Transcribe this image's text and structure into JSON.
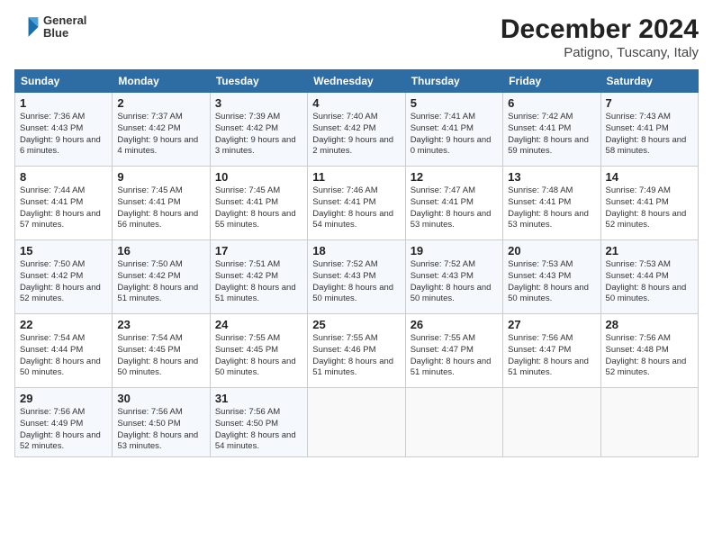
{
  "logo": {
    "line1": "General",
    "line2": "Blue"
  },
  "title": "December 2024",
  "subtitle": "Patigno, Tuscany, Italy",
  "weekdays": [
    "Sunday",
    "Monday",
    "Tuesday",
    "Wednesday",
    "Thursday",
    "Friday",
    "Saturday"
  ],
  "weeks": [
    [
      {
        "day": "1",
        "sunrise": "7:36 AM",
        "sunset": "4:43 PM",
        "daylight": "9 hours and 6 minutes."
      },
      {
        "day": "2",
        "sunrise": "7:37 AM",
        "sunset": "4:42 PM",
        "daylight": "9 hours and 4 minutes."
      },
      {
        "day": "3",
        "sunrise": "7:39 AM",
        "sunset": "4:42 PM",
        "daylight": "9 hours and 3 minutes."
      },
      {
        "day": "4",
        "sunrise": "7:40 AM",
        "sunset": "4:42 PM",
        "daylight": "9 hours and 2 minutes."
      },
      {
        "day": "5",
        "sunrise": "7:41 AM",
        "sunset": "4:41 PM",
        "daylight": "9 hours and 0 minutes."
      },
      {
        "day": "6",
        "sunrise": "7:42 AM",
        "sunset": "4:41 PM",
        "daylight": "8 hours and 59 minutes."
      },
      {
        "day": "7",
        "sunrise": "7:43 AM",
        "sunset": "4:41 PM",
        "daylight": "8 hours and 58 minutes."
      }
    ],
    [
      {
        "day": "8",
        "sunrise": "7:44 AM",
        "sunset": "4:41 PM",
        "daylight": "8 hours and 57 minutes."
      },
      {
        "day": "9",
        "sunrise": "7:45 AM",
        "sunset": "4:41 PM",
        "daylight": "8 hours and 56 minutes."
      },
      {
        "day": "10",
        "sunrise": "7:45 AM",
        "sunset": "4:41 PM",
        "daylight": "8 hours and 55 minutes."
      },
      {
        "day": "11",
        "sunrise": "7:46 AM",
        "sunset": "4:41 PM",
        "daylight": "8 hours and 54 minutes."
      },
      {
        "day": "12",
        "sunrise": "7:47 AM",
        "sunset": "4:41 PM",
        "daylight": "8 hours and 53 minutes."
      },
      {
        "day": "13",
        "sunrise": "7:48 AM",
        "sunset": "4:41 PM",
        "daylight": "8 hours and 53 minutes."
      },
      {
        "day": "14",
        "sunrise": "7:49 AM",
        "sunset": "4:41 PM",
        "daylight": "8 hours and 52 minutes."
      }
    ],
    [
      {
        "day": "15",
        "sunrise": "7:50 AM",
        "sunset": "4:42 PM",
        "daylight": "8 hours and 52 minutes."
      },
      {
        "day": "16",
        "sunrise": "7:50 AM",
        "sunset": "4:42 PM",
        "daylight": "8 hours and 51 minutes."
      },
      {
        "day": "17",
        "sunrise": "7:51 AM",
        "sunset": "4:42 PM",
        "daylight": "8 hours and 51 minutes."
      },
      {
        "day": "18",
        "sunrise": "7:52 AM",
        "sunset": "4:43 PM",
        "daylight": "8 hours and 50 minutes."
      },
      {
        "day": "19",
        "sunrise": "7:52 AM",
        "sunset": "4:43 PM",
        "daylight": "8 hours and 50 minutes."
      },
      {
        "day": "20",
        "sunrise": "7:53 AM",
        "sunset": "4:43 PM",
        "daylight": "8 hours and 50 minutes."
      },
      {
        "day": "21",
        "sunrise": "7:53 AM",
        "sunset": "4:44 PM",
        "daylight": "8 hours and 50 minutes."
      }
    ],
    [
      {
        "day": "22",
        "sunrise": "7:54 AM",
        "sunset": "4:44 PM",
        "daylight": "8 hours and 50 minutes."
      },
      {
        "day": "23",
        "sunrise": "7:54 AM",
        "sunset": "4:45 PM",
        "daylight": "8 hours and 50 minutes."
      },
      {
        "day": "24",
        "sunrise": "7:55 AM",
        "sunset": "4:45 PM",
        "daylight": "8 hours and 50 minutes."
      },
      {
        "day": "25",
        "sunrise": "7:55 AM",
        "sunset": "4:46 PM",
        "daylight": "8 hours and 51 minutes."
      },
      {
        "day": "26",
        "sunrise": "7:55 AM",
        "sunset": "4:47 PM",
        "daylight": "8 hours and 51 minutes."
      },
      {
        "day": "27",
        "sunrise": "7:56 AM",
        "sunset": "4:47 PM",
        "daylight": "8 hours and 51 minutes."
      },
      {
        "day": "28",
        "sunrise": "7:56 AM",
        "sunset": "4:48 PM",
        "daylight": "8 hours and 52 minutes."
      }
    ],
    [
      {
        "day": "29",
        "sunrise": "7:56 AM",
        "sunset": "4:49 PM",
        "daylight": "8 hours and 52 minutes."
      },
      {
        "day": "30",
        "sunrise": "7:56 AM",
        "sunset": "4:50 PM",
        "daylight": "8 hours and 53 minutes."
      },
      {
        "day": "31",
        "sunrise": "7:56 AM",
        "sunset": "4:50 PM",
        "daylight": "8 hours and 54 minutes."
      },
      null,
      null,
      null,
      null
    ]
  ]
}
